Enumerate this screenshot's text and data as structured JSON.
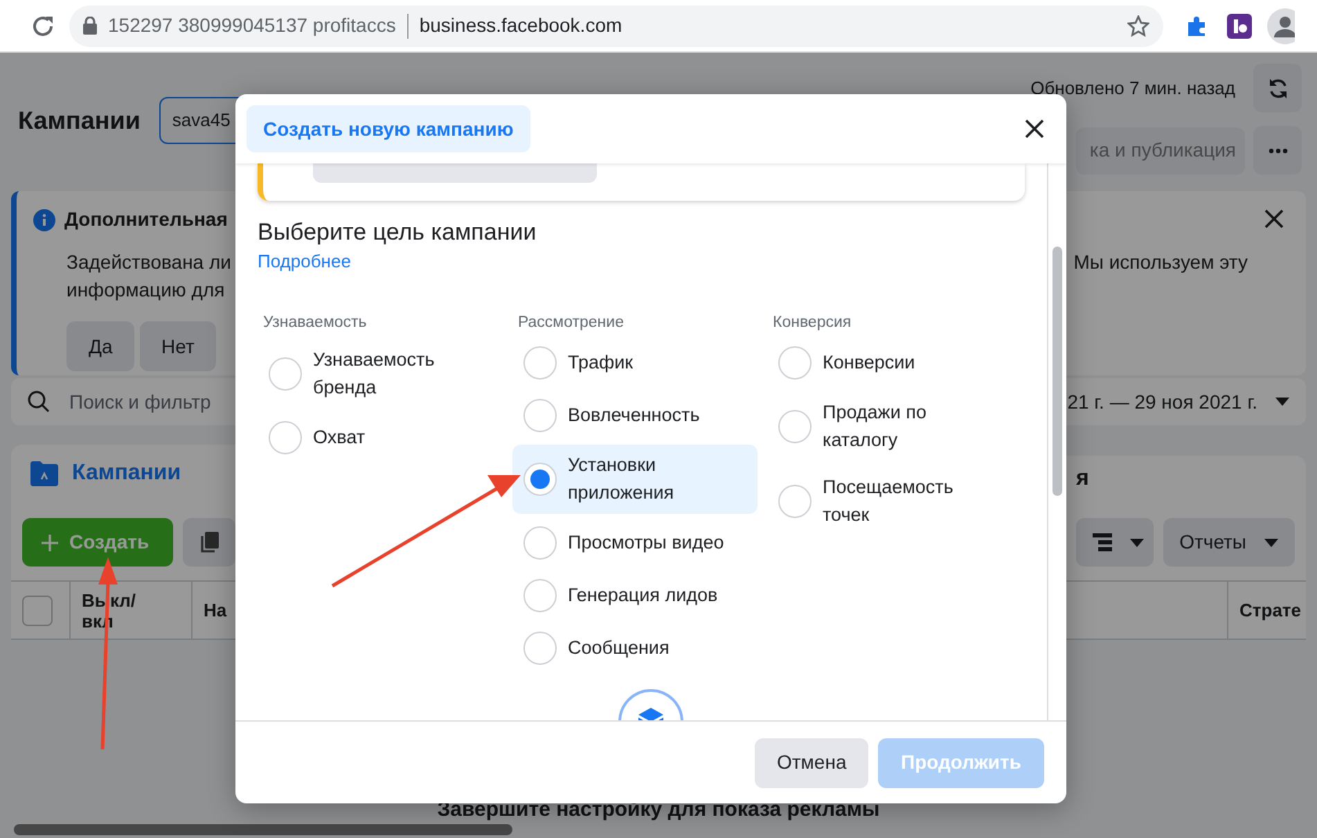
{
  "browser": {
    "site_label": "152297 380999045137 profitaccs",
    "url": "business.facebook.com"
  },
  "page": {
    "title": "Кампании",
    "account_value": "sava45",
    "updated": "Обновлено 7 мин. назад",
    "publish_button": "ка и публикация",
    "banner": {
      "title": "Дополнительная",
      "line_1": "Задействована ли",
      "line_1_right": "Мы используем эту",
      "line_2": "информацию для",
      "buttons": [
        "Да",
        "Нет"
      ]
    },
    "search": {
      "placeholder": "Поиск и фильтр",
      "date_range": "21 г. — 29 ноя 2021 г."
    },
    "tabs": [
      {
        "label": "Кампании",
        "selected": true
      },
      {
        "label": "я",
        "selected": false
      }
    ],
    "toolbar": {
      "create": "Создать",
      "reports": "Отчеты"
    },
    "table": {
      "select_all_checked": false,
      "columns": [
        "Выкл/\nвкл",
        "На",
        "Страте"
      ]
    },
    "notice": {
      "title": "Завершите настройку для показа рекламы"
    }
  },
  "modal": {
    "tab": "Создать новую кампанию",
    "heading": "Выберите цель кампании",
    "link": "Подробнее",
    "groups": [
      {
        "title": "Узнаваемость",
        "options": [
          {
            "label": "Узнаваемость\nбренда",
            "selected": false
          },
          {
            "label": "Охват",
            "selected": false
          }
        ]
      },
      {
        "title": "Рассмотрение",
        "options": [
          {
            "label": "Трафик",
            "selected": false
          },
          {
            "label": "Вовлеченность",
            "selected": false
          },
          {
            "label": "Установки\nприложения",
            "selected": true
          },
          {
            "label": "Просмотры видео",
            "selected": false
          },
          {
            "label": "Генерация лидов",
            "selected": false
          },
          {
            "label": "Сообщения",
            "selected": false
          }
        ]
      },
      {
        "title": "Конверсия",
        "options": [
          {
            "label": "Конверсии",
            "selected": false
          },
          {
            "label": "Продажи по\nкаталогу",
            "selected": false
          },
          {
            "label": "Посещаемость\nточек",
            "selected": false
          }
        ]
      }
    ],
    "buttons": [
      {
        "label": "Отмена",
        "kind": "secondary",
        "disabled": false
      },
      {
        "label": "Продолжить",
        "kind": "primary",
        "disabled": true
      }
    ]
  }
}
